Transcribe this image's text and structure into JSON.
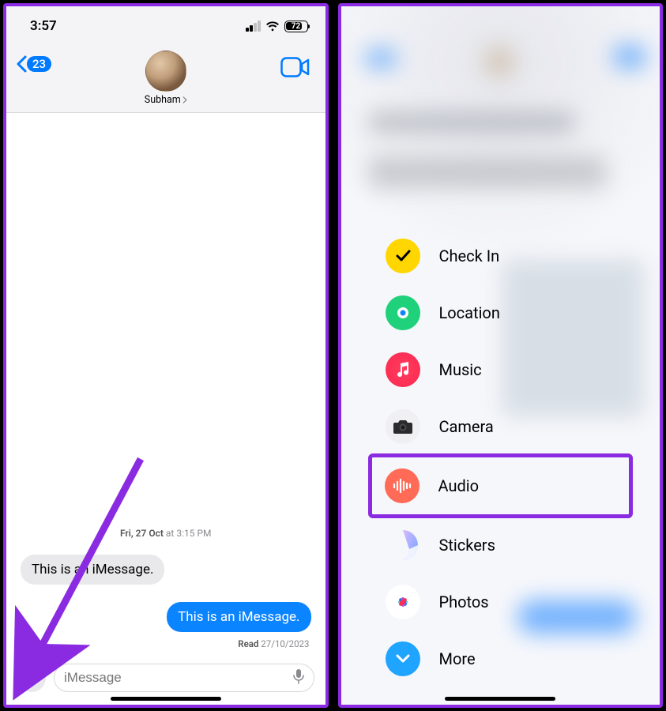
{
  "status": {
    "time": "3:57",
    "battery_pct": "72"
  },
  "nav": {
    "back_count": "23",
    "contact_name": "Subham"
  },
  "chat": {
    "timestamp_day": "Fri, 27 Oct",
    "timestamp_at": " at ",
    "timestamp_time": "3:15 PM",
    "incoming_msg": "This is an iMessage.",
    "outgoing_msg": "This is an iMessage.",
    "read_label": "Read",
    "read_date": " 27/10/2023"
  },
  "compose": {
    "placeholder": "iMessage"
  },
  "menu": {
    "items": [
      {
        "label": "Check In"
      },
      {
        "label": "Location"
      },
      {
        "label": "Music"
      },
      {
        "label": "Camera"
      },
      {
        "label": "Audio"
      },
      {
        "label": "Stickers"
      },
      {
        "label": "Photos"
      },
      {
        "label": "More"
      }
    ]
  }
}
